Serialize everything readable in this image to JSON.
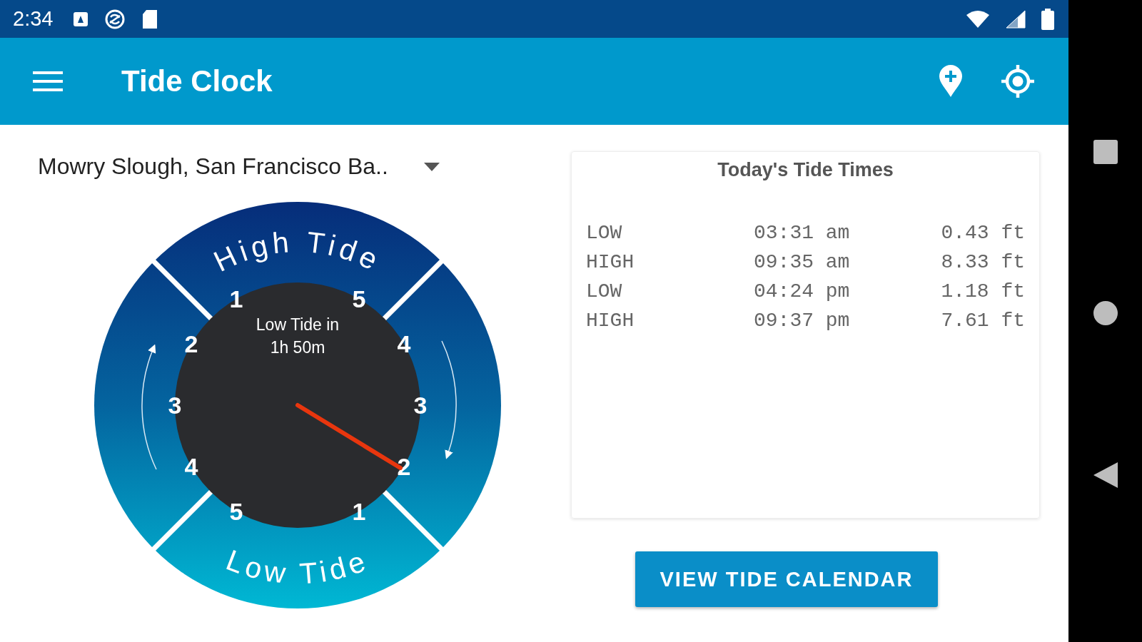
{
  "status_bar": {
    "time": "2:34"
  },
  "app_bar": {
    "title": "Tide Clock"
  },
  "location_select": {
    "value": "Mowry Slough, San Francisco Ba.."
  },
  "clock": {
    "high_label": "High Tide",
    "low_label": "Low Tide",
    "countdown": [
      "Low Tide in",
      "1h 50m"
    ],
    "left_numbers": [
      "1",
      "2",
      "3",
      "4",
      "5"
    ],
    "right_numbers": [
      "5",
      "4",
      "3",
      "2",
      "1"
    ]
  },
  "tide_times": {
    "title": "Today's Tide Times",
    "rows": [
      {
        "type": "LOW",
        "time": "03:31 am",
        "height": "0.43 ft"
      },
      {
        "type": "HIGH",
        "time": "09:35 am",
        "height": "8.33 ft"
      },
      {
        "type": "LOW",
        "time": "04:24 pm",
        "height": "1.18 ft"
      },
      {
        "type": "HIGH",
        "time": "09:37 pm",
        "height": "7.61 ft"
      }
    ]
  },
  "calendar_button": {
    "label": "VIEW TIDE CALENDAR"
  }
}
